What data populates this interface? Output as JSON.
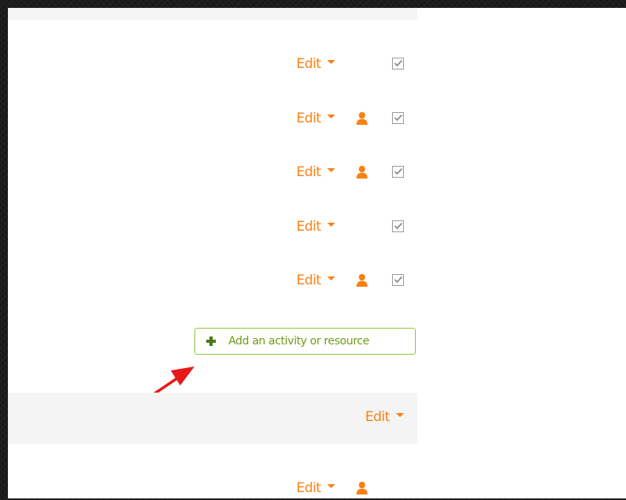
{
  "colors": {
    "accent_orange": "#f98012",
    "add_button_green": "#6c9c18",
    "add_button_border": "#8dc63f",
    "annotation_arrow": "#e81818",
    "section_header_bg": "#f4f4f4"
  },
  "activities": [
    {
      "edit_label": "Edit",
      "has_user_icon": false,
      "completion_checked": true
    },
    {
      "edit_label": "Edit",
      "has_user_icon": true,
      "completion_checked": true
    },
    {
      "edit_label": "Edit",
      "has_user_icon": true,
      "completion_checked": true
    },
    {
      "edit_label": "Edit",
      "has_user_icon": false,
      "completion_checked": true
    },
    {
      "edit_label": "Edit",
      "has_user_icon": true,
      "completion_checked": true
    }
  ],
  "add_activity": {
    "label": "Add an activity or resource",
    "icon": "plus-icon"
  },
  "next_section": {
    "edit_label": "Edit"
  },
  "next_section_activity": {
    "edit_label": "Edit",
    "has_user_icon": true
  },
  "icons": {
    "edit_caret": "caret-down-icon",
    "user": "user-icon",
    "completion": "checkbox-checked-icon",
    "annotation": "red-arrow"
  }
}
